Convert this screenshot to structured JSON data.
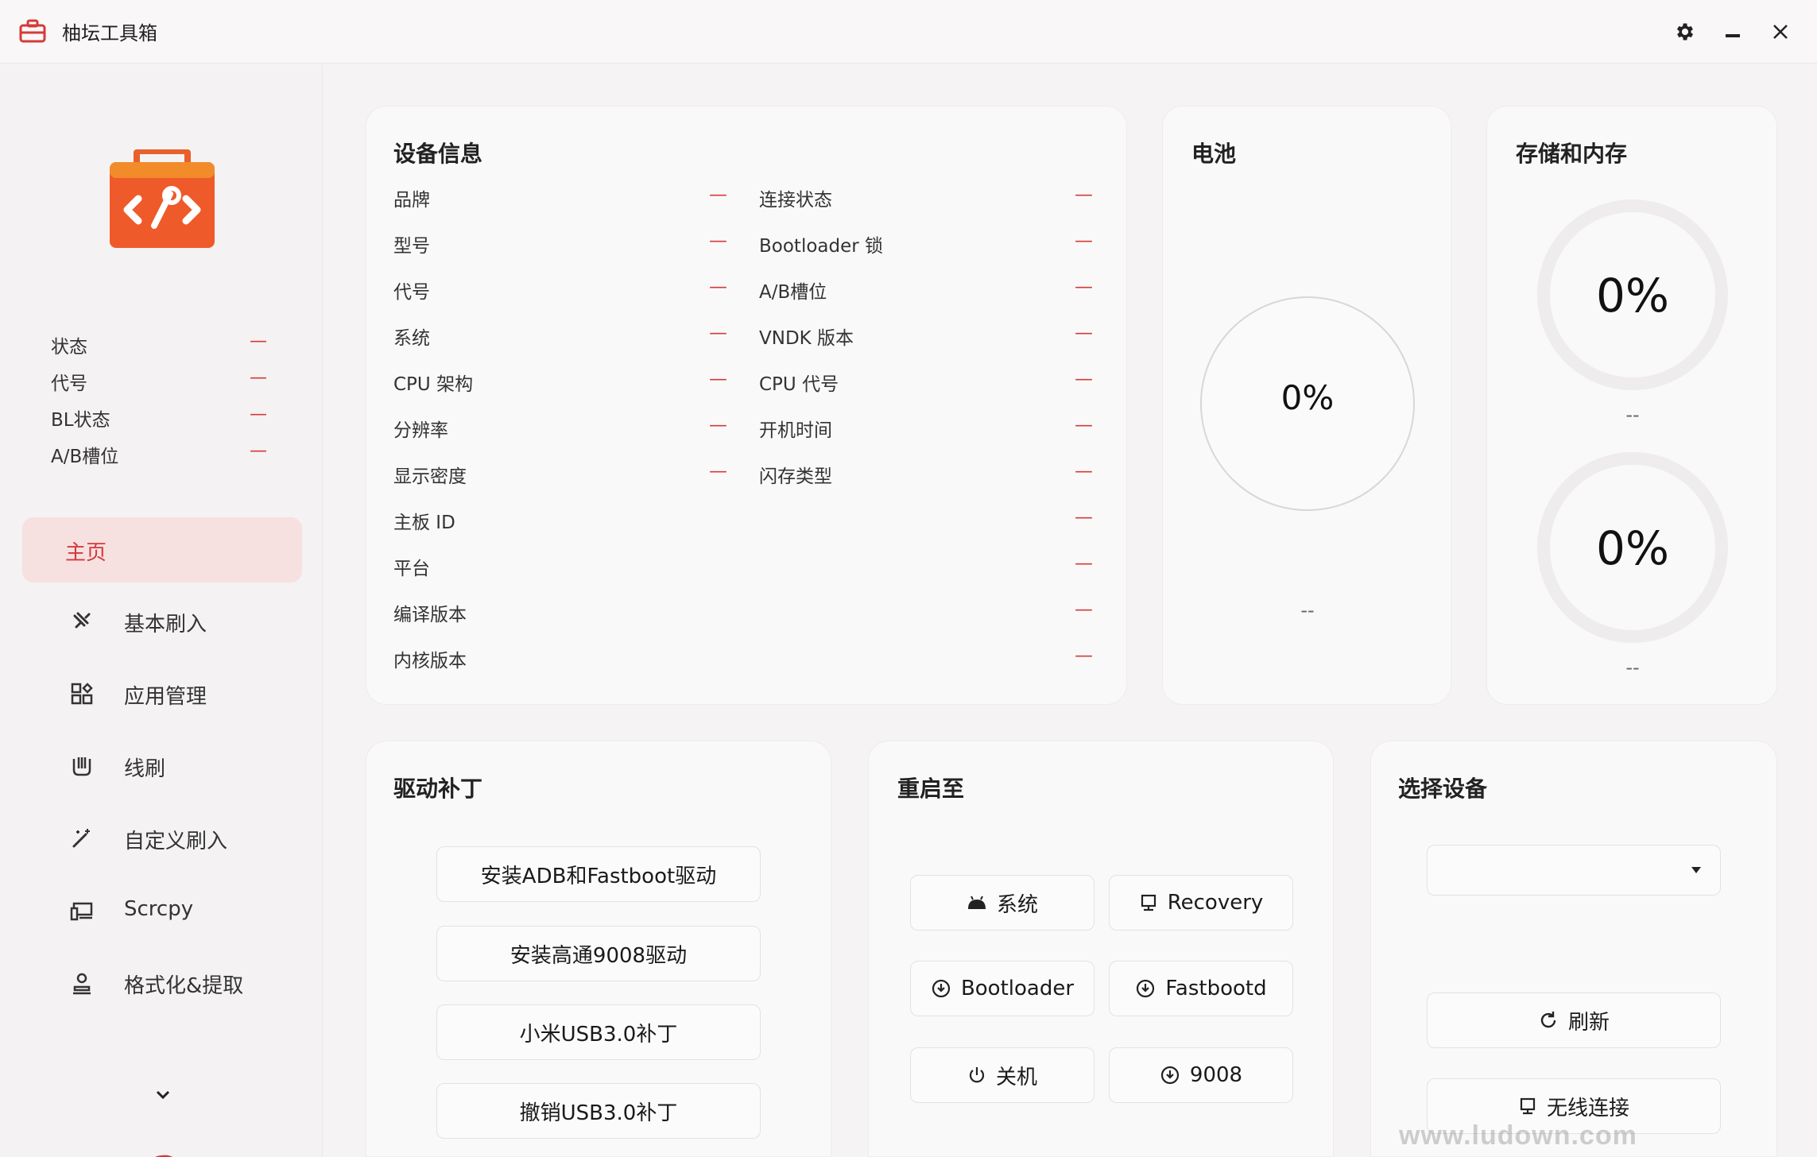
{
  "window": {
    "title": "柚坛工具箱",
    "icons": {
      "app": "toolbox-icon",
      "settings": "gear-icon",
      "minimize": "minimize-icon",
      "close": "close-icon"
    }
  },
  "sidebar": {
    "status": [
      {
        "label": "状态",
        "value": "—"
      },
      {
        "label": "代号",
        "value": "—"
      },
      {
        "label": "BL状态",
        "value": "—"
      },
      {
        "label": "A/B槽位",
        "value": "—"
      }
    ],
    "nav": [
      {
        "label": "主页"
      },
      {
        "label": "基本刷入",
        "icon": "flash-icon"
      },
      {
        "label": "应用管理",
        "icon": "apps-grid-icon"
      },
      {
        "label": "线刷",
        "icon": "usb-flash-icon"
      },
      {
        "label": "自定义刷入",
        "icon": "magic-wand-icon"
      },
      {
        "label": "Scrcpy",
        "icon": "screen-mirror-icon"
      },
      {
        "label": "格式化&提取",
        "icon": "format-icon"
      }
    ]
  },
  "device_info": {
    "title": "设备信息",
    "left": [
      {
        "label": "品牌",
        "value": "—"
      },
      {
        "label": "型号",
        "value": "—"
      },
      {
        "label": "代号",
        "value": "—"
      },
      {
        "label": "系统",
        "value": "—"
      },
      {
        "label": "CPU 架构",
        "value": "—"
      },
      {
        "label": "分辨率",
        "value": "—"
      },
      {
        "label": "显示密度",
        "value": "—"
      }
    ],
    "right": [
      {
        "label": "连接状态",
        "value": "—"
      },
      {
        "label": "Bootloader 锁",
        "value": "—"
      },
      {
        "label": "A/B槽位",
        "value": "—"
      },
      {
        "label": "VNDK 版本",
        "value": "—"
      },
      {
        "label": "CPU 代号",
        "value": "—"
      },
      {
        "label": "开机时间",
        "value": "—"
      },
      {
        "label": "闪存类型",
        "value": "—"
      }
    ],
    "full": [
      {
        "label": "主板 ID",
        "value": "—"
      },
      {
        "label": "平台",
        "value": "—"
      },
      {
        "label": "编译版本",
        "value": "—"
      },
      {
        "label": "内核版本",
        "value": "—"
      }
    ]
  },
  "battery": {
    "title": "电池",
    "percent_text": "0%",
    "level": 0,
    "detail": "--"
  },
  "storage": {
    "title": "存储和内存",
    "storage_percent_text": "0%",
    "storage_level": 0,
    "storage_detail": "--",
    "memory_percent_text": "0%",
    "memory_level": 0,
    "memory_detail": "--"
  },
  "driver": {
    "title": "驱动补丁",
    "buttons": [
      "安装ADB和Fastboot驱动",
      "安装高通9008驱动",
      "小米USB3.0补丁",
      "撤销USB3.0补丁"
    ]
  },
  "reboot": {
    "title": "重启至",
    "buttons": [
      {
        "label": "系统",
        "icon": "android-icon"
      },
      {
        "label": "Recovery",
        "icon": "monitor-icon"
      },
      {
        "label": "Bootloader",
        "icon": "reboot-icon"
      },
      {
        "label": "Fastbootd",
        "icon": "reboot-icon"
      },
      {
        "label": "关机",
        "icon": "power-icon"
      },
      {
        "label": "9008",
        "icon": "reboot-icon"
      }
    ]
  },
  "device_select": {
    "title": "选择设备",
    "selected": "",
    "refresh_label": "刷新",
    "wireless_label": "无线连接"
  },
  "watermark": "www.ludown.com"
}
